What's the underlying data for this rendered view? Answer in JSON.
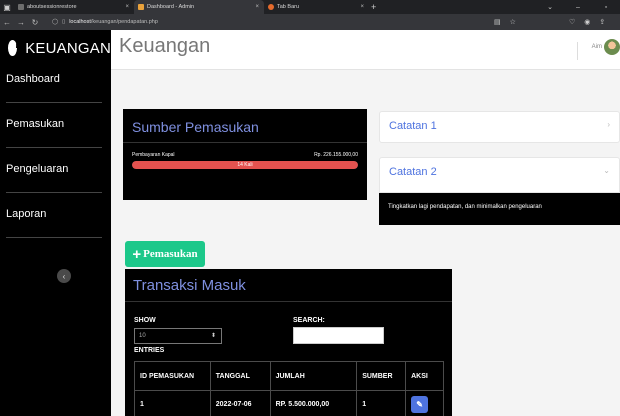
{
  "browser": {
    "tabs": [
      {
        "title": "aboutsessionrestore"
      },
      {
        "title": "Dashboard - Admin"
      },
      {
        "title": "Tab Baru"
      }
    ],
    "url_host": "localhost",
    "url_path": "/keuangan/pendapatan.php"
  },
  "sidebar": {
    "brand": "KEUANGAN",
    "items": [
      {
        "label": "Dashboard"
      },
      {
        "label": "Pemasukan"
      },
      {
        "label": "Pengeluaran"
      },
      {
        "label": "Laporan"
      }
    ]
  },
  "topbar": {
    "title": "Keuangan",
    "username": "Aim"
  },
  "sumber": {
    "title": "Sumber Pemasukan",
    "source": "Pembayaran Kapal",
    "amount": "Rp. 226.155.000,00",
    "bar_label": "14 Kali",
    "bar_fraction": 1.0,
    "bar_color": "#e4524f"
  },
  "catatan1": {
    "title": "Catatan 1"
  },
  "catatan2": {
    "title": "Catatan 2",
    "body": "Tingkatkan lagi pendapatan, dan minimalkan pengeluaran"
  },
  "add_button": {
    "label": "Pemasukan"
  },
  "transaksi": {
    "title": "Transaksi Masuk",
    "show_label": "SHOW",
    "entries_value": "10",
    "entries_label": "ENTRIES",
    "search_label": "SEARCH:",
    "search_value": "",
    "columns": [
      "ID PEMASUKAN",
      "TANGGAL",
      "JUMLAH",
      "SUMBER",
      "AKSI"
    ],
    "rows": [
      {
        "id": "1",
        "tanggal": "2022-07-06",
        "jumlah": "RP. 5.500.000,00",
        "sumber": "1"
      }
    ]
  },
  "colors": {
    "accent_blue": "#4e73df",
    "title_blue": "#7f90e0",
    "success_green": "#1cc88a",
    "danger_red": "#e4524f"
  }
}
